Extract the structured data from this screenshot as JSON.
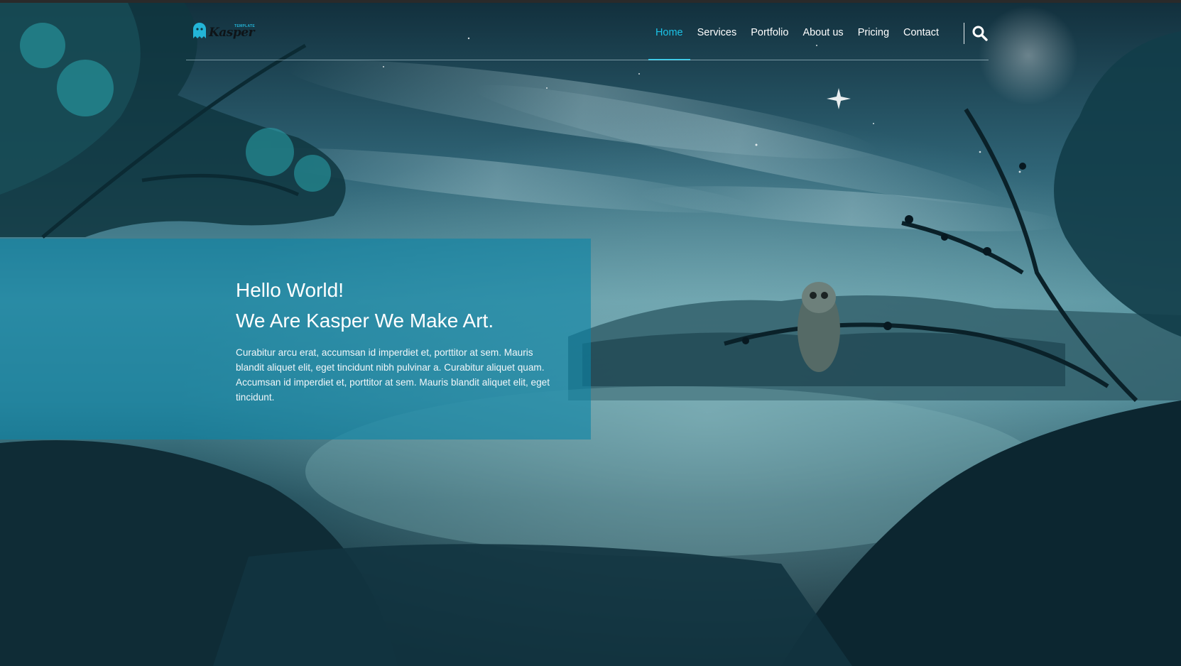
{
  "logo": {
    "tag": "TEMPLATE",
    "name": "Kasper",
    "color": "#23b5d8"
  },
  "nav": {
    "items": [
      {
        "label": "Home",
        "active": true
      },
      {
        "label": "Services",
        "active": false
      },
      {
        "label": "Portfolio",
        "active": false
      },
      {
        "label": "About us",
        "active": false
      },
      {
        "label": "Pricing",
        "active": false
      },
      {
        "label": "Contact",
        "active": false
      }
    ],
    "active_color": "#1bc3e7",
    "search_icon": "search-icon"
  },
  "intro": {
    "line1": "Hello World!",
    "line2": "We Are Kasper We Make Art.",
    "description": "Curabitur arcu erat, accumsan id imperdiet et, porttitor at sem. Mauris blandit aliquet elit, eget tincidunt nibh pulvinar a. Curabitur aliquet quam. Accumsan id imperdiet et, porttitor at sem. Mauris blandit aliquet elit, eget tincidunt.",
    "box_color": "#0c85a7"
  },
  "colors": {
    "sky_top": "#1a3a48",
    "sky_mid": "#4f8a98",
    "lake": "#6fa3ac",
    "foliage": "#0b2530",
    "highlight": "#29c4d0"
  }
}
